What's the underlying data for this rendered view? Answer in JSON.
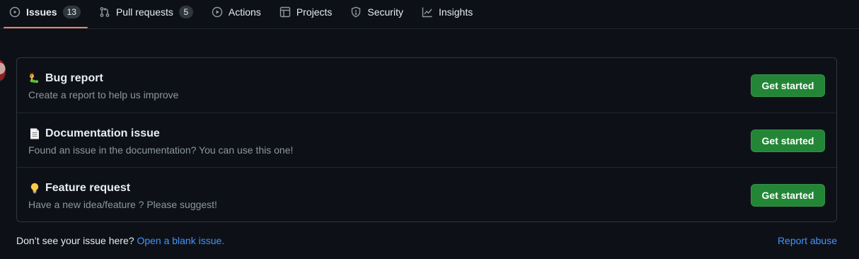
{
  "tabs": [
    {
      "label": "Issues",
      "icon": "issue-opened-icon",
      "count": "13",
      "selected": true
    },
    {
      "label": "Pull requests",
      "icon": "git-pull-request-icon",
      "count": "5"
    },
    {
      "label": "Actions",
      "icon": "play-icon"
    },
    {
      "label": "Projects",
      "icon": "table-icon"
    },
    {
      "label": "Security",
      "icon": "shield-icon"
    },
    {
      "label": "Insights",
      "icon": "graph-icon"
    }
  ],
  "templates": [
    {
      "emoji": "bug-emoji",
      "title": "Bug report",
      "description": "Create a report to help us improve",
      "button": "Get started"
    },
    {
      "emoji": "page-emoji",
      "title": "Documentation issue",
      "description": "Found an issue in the documentation? You can use this one!",
      "button": "Get started"
    },
    {
      "emoji": "lightbulb-emoji",
      "title": "Feature request",
      "description": "Have a new idea/feature ? Please suggest!",
      "button": "Get started"
    }
  ],
  "footer": {
    "prompt": "Don’t see your issue here?",
    "blank_link": "Open a blank issue.",
    "report_link": "Report abuse"
  },
  "colors": {
    "background": "#0d1117",
    "accent_underline": "#f78166",
    "button_green": "#238636",
    "link_blue": "#4493f8",
    "muted_text": "#8d96a0"
  }
}
